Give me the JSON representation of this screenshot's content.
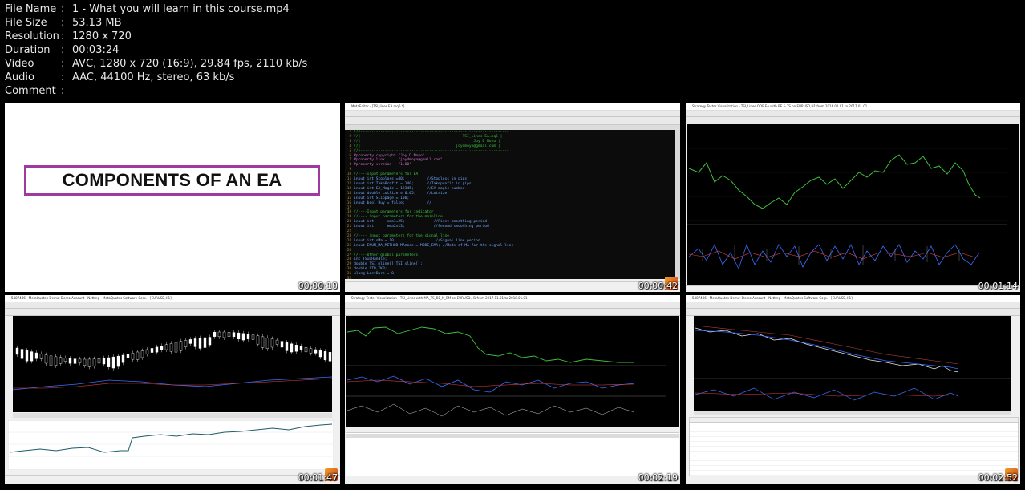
{
  "file_info": {
    "rows": [
      {
        "label": "File Name",
        "value": "1 - What you will learn in this course.mp4"
      },
      {
        "label": "File Size",
        "value": "53.13 MB"
      },
      {
        "label": "Resolution",
        "value": "1280 x 720"
      },
      {
        "label": "Duration",
        "value": "00:03:24"
      },
      {
        "label": "Video",
        "value": "AVC, 1280 x 720 (16:9), 29.84 fps, 2110 kb/s"
      },
      {
        "label": "Audio",
        "value": "AAC, 44100 Hz, stereo, 63 kb/s"
      },
      {
        "label": "Comment",
        "value": ""
      }
    ],
    "separator": ":"
  },
  "thumbnails": [
    {
      "timestamp": "00:00:10",
      "slide_title": "COMPONENTS OF AN EA"
    },
    {
      "timestamp": "00:00:42",
      "window_title": "MetaEditor - [TSI_lines EA.mq5 *]"
    },
    {
      "timestamp": "00:01:14",
      "window_title": "Strategy Tester Visualization - TSI_Lines OOP EA with BE & TS on EURUSD,H1 from 2016.01.01 to 2017.01.01"
    },
    {
      "timestamp": "00:01:47",
      "window_title": "5487406 - MetaQuotes-Demo: Demo Account - Netting - MetaQuotes Software Corp. - [EURUSD,H1]"
    },
    {
      "timestamp": "00:02:19",
      "window_title": "Strategy Tester Visualization - TSI_Lines with MA_TS_BE_N_BM on EURUSD,H1 from 2017.11.01 to 2018.01.01"
    },
    {
      "timestamp": "00:02:52",
      "window_title": "5487406 - MetaQuotes-Demo: Demo Account - Netting - MetaQuotes Software Corp. - [EURUSD,H1]"
    }
  ],
  "code_lines": [
    {
      "n": "1",
      "t": "//+------------------------------------------------------------------+"
    },
    {
      "n": "2",
      "t": "//|                                              TSI_lines EA.mq5 |"
    },
    {
      "n": "3",
      "t": "//|                                                   Joy D Moyo |"
    },
    {
      "n": "4",
      "t": "//|                                           joydmoyo@gmail.com |"
    },
    {
      "n": "5",
      "t": "//+------------------------------------------------------------------+"
    },
    {
      "n": "6",
      "t": "#property copyright \"Joy D Moyo\""
    },
    {
      "n": "7",
      "t": "#property link      \"joydmoyo@gmail.com\""
    },
    {
      "n": "8",
      "t": "#property version   \"1.00\""
    },
    {
      "n": "9",
      "t": ""
    },
    {
      "n": "10",
      "t": "//----Input parameters for EA"
    },
    {
      "n": "11",
      "t": "input int Stoploss =40;          //Stoploss in pips"
    },
    {
      "n": "12",
      "t": "input int TakeProfit = 140;      //Takeprofit in pips"
    },
    {
      "n": "13",
      "t": "input int EA_Magic = 12345;      //EA magic number"
    },
    {
      "n": "14",
      "t": "input double LotSize = 0.05;     //Lotsize"
    },
    {
      "n": "15",
      "t": "input int Slippage = 100;"
    },
    {
      "n": "16",
      "t": "input bool Buy = false;          //"
    },
    {
      "n": "17",
      "t": ""
    },
    {
      "n": "18",
      "t": "//----Input parameters for indicator"
    },
    {
      "n": "19",
      "t": "//---- input parameters for the mainline"
    },
    {
      "n": "20",
      "t": "input int      ema1=25;             //First smoothing period"
    },
    {
      "n": "21",
      "t": "input int      ema2=13;             //Second smoothing period"
    },
    {
      "n": "22",
      "t": ""
    },
    {
      "n": "23",
      "t": "//---- input parameters for the signal line"
    },
    {
      "n": "24",
      "t": "input int sMa = 10;                  //Signal line period"
    },
    {
      "n": "25",
      "t": "input ENUM_MA_METHOD MAmode = MODE_EMA; //Mode of MA for the signal line"
    },
    {
      "n": "26",
      "t": ""
    },
    {
      "n": "27",
      "t": "//----Other global parameters"
    },
    {
      "n": "28",
      "t": "int TSIDHandle;"
    },
    {
      "n": "29",
      "t": "double TSI_mline[],TSI_sline[];"
    },
    {
      "n": "30",
      "t": "double STP,TKP;"
    },
    {
      "n": "31",
      "t": "ulong LastBars = 0;"
    },
    {
      "n": "32",
      "t": ""
    }
  ],
  "colors": {
    "background": "#000000",
    "text": "#e8e8e8",
    "chart_green": "#3fbf3f",
    "chart_blue": "#3a6dff",
    "slide_border": "#a03aa0"
  }
}
